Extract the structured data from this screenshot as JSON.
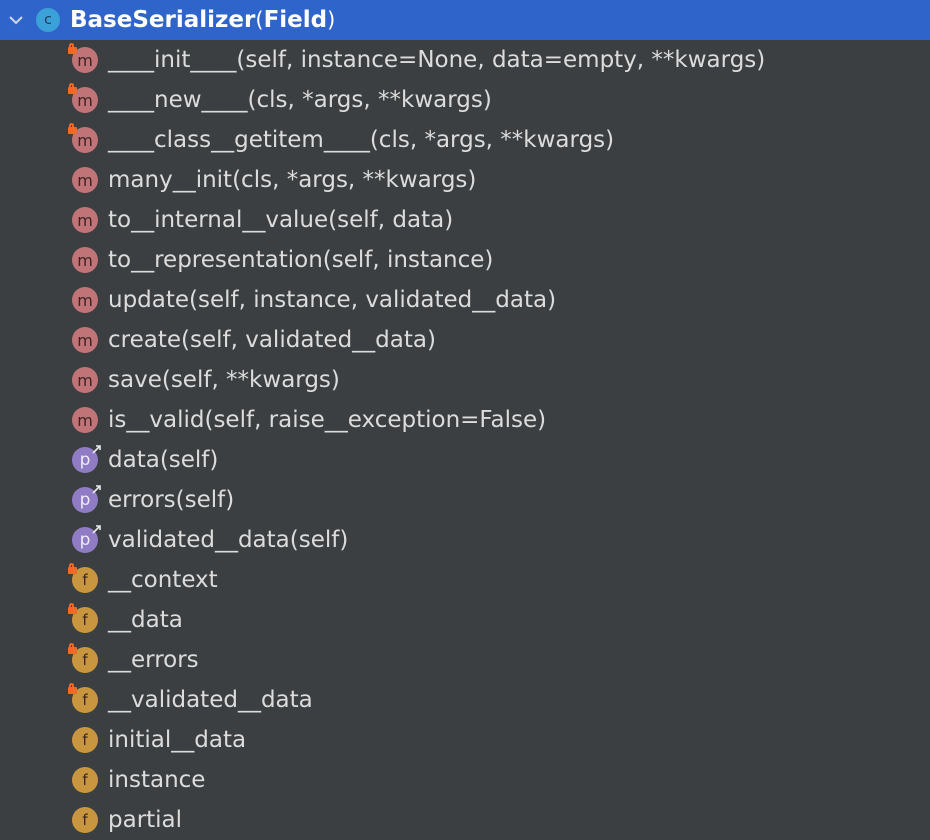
{
  "class_node": {
    "name": "BaseSerializer",
    "open_paren": "(",
    "base": "Field",
    "close_paren": ")",
    "icon": "class-icon",
    "icon_letter": "c",
    "expanded": true
  },
  "members": [
    {
      "kind": "m",
      "locked": true,
      "name": "____init____",
      "params": "(self, instance=None, data=empty, **kwargs)"
    },
    {
      "kind": "m",
      "locked": true,
      "name": "____new____",
      "params": "(cls, *args, **kwargs)"
    },
    {
      "kind": "m",
      "locked": true,
      "name": "____class__getitem____",
      "params": "(cls, *args, **kwargs)"
    },
    {
      "kind": "m",
      "locked": false,
      "name": "many__init",
      "params": "(cls, *args, **kwargs)"
    },
    {
      "kind": "m",
      "locked": false,
      "name": "to__internal__value",
      "params": "(self, data)"
    },
    {
      "kind": "m",
      "locked": false,
      "name": "to__representation",
      "params": "(self, instance)"
    },
    {
      "kind": "m",
      "locked": false,
      "name": "update",
      "params": "(self, instance, validated__data)"
    },
    {
      "kind": "m",
      "locked": false,
      "name": "create",
      "params": "(self, validated__data)"
    },
    {
      "kind": "m",
      "locked": false,
      "name": "save",
      "params": "(self, **kwargs)"
    },
    {
      "kind": "m",
      "locked": false,
      "name": "is__valid",
      "params": "(self, raise__exception=False)"
    },
    {
      "kind": "p",
      "locked": false,
      "name": "data",
      "params": "(self)"
    },
    {
      "kind": "p",
      "locked": false,
      "name": "errors",
      "params": "(self)"
    },
    {
      "kind": "p",
      "locked": false,
      "name": "validated__data",
      "params": "(self)"
    },
    {
      "kind": "f",
      "locked": true,
      "name": "__context",
      "params": ""
    },
    {
      "kind": "f",
      "locked": true,
      "name": "__data",
      "params": ""
    },
    {
      "kind": "f",
      "locked": true,
      "name": "__errors",
      "params": ""
    },
    {
      "kind": "f",
      "locked": true,
      "name": "__validated__data",
      "params": ""
    },
    {
      "kind": "f",
      "locked": false,
      "name": "initial__data",
      "params": ""
    },
    {
      "kind": "f",
      "locked": false,
      "name": "instance",
      "params": ""
    },
    {
      "kind": "f",
      "locked": false,
      "name": "partial",
      "params": ""
    }
  ],
  "icon_letters": {
    "m": "m",
    "p": "p",
    "f": "f"
  },
  "icon_names": {
    "m": "method-icon",
    "p": "property-icon",
    "f": "field-icon"
  },
  "colors": {
    "background": "#3c3f41",
    "selection": "#2f65ca",
    "method": "#c07478",
    "property": "#8f7cc4",
    "field": "#c8963e",
    "class": "#3aa2d8",
    "lock": "#ee6a28"
  }
}
